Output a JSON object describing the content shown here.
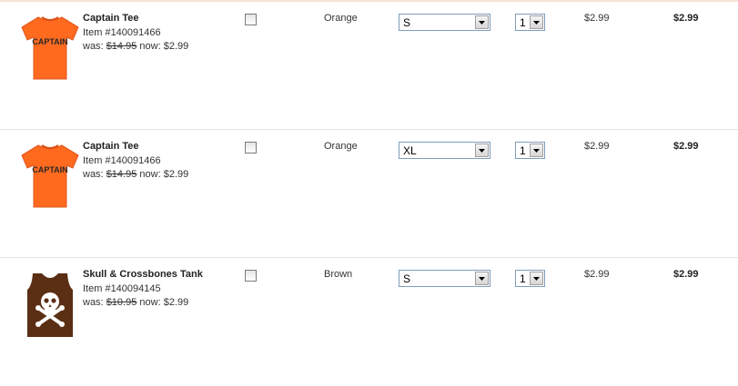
{
  "cart": {
    "items": [
      {
        "name": "Captain Tee",
        "item_number": "Item #140091466",
        "was_label": "was:",
        "was_price": "$14.95",
        "now_label": "now:",
        "now_price": "$2.99",
        "color": "Orange",
        "size": "S",
        "quantity": "1",
        "unit_price": "$2.99",
        "total_price": "$2.99",
        "selected": false,
        "image": "orange-captain-tshirt",
        "image_text": "CAPTAIN"
      },
      {
        "name": "Captain Tee",
        "item_number": "Item #140091466",
        "was_label": "was:",
        "was_price": "$14.95",
        "now_label": "now:",
        "now_price": "$2.99",
        "color": "Orange",
        "size": "XL",
        "quantity": "1",
        "unit_price": "$2.99",
        "total_price": "$2.99",
        "selected": false,
        "image": "orange-captain-tshirt",
        "image_text": "CAPTAIN"
      },
      {
        "name": "Skull & Crossbones Tank",
        "item_number": "Item #140094145",
        "was_label": "was:",
        "was_price": "$10.95",
        "now_label": "now:",
        "now_price": "$2.99",
        "color": "Brown",
        "size": "S",
        "quantity": "1",
        "unit_price": "$2.99",
        "total_price": "$2.99",
        "selected": false,
        "image": "brown-skull-tank",
        "image_text": ""
      }
    ]
  },
  "colors": {
    "tee_orange": "#ff6a1f",
    "tank_brown": "#5a2f14",
    "tee_lettering": "#2a2a2a",
    "divider": "#e3e3e3"
  },
  "icons": {
    "dropdown": "chevron-down-icon",
    "checkbox": "checkbox"
  }
}
